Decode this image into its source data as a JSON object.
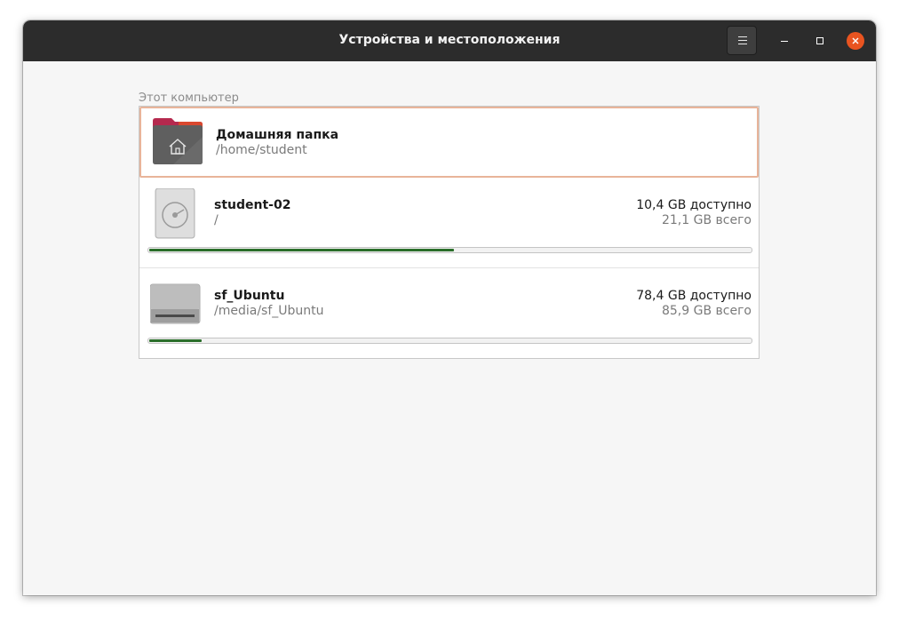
{
  "window": {
    "title": "Устройства и местоположения"
  },
  "section": {
    "label": "Этот компьютер"
  },
  "items": [
    {
      "name": "Домашняя папка",
      "path": "/home/student",
      "icon": "home-folder-icon"
    },
    {
      "name": "student-02",
      "path": "/",
      "free": "10,4 GB доступно",
      "total": "21,1 GB всего",
      "used_fraction": 0.507,
      "icon": "disk-icon"
    },
    {
      "name": "sf_Ubuntu",
      "path": "/media/sf_Ubuntu",
      "free": "78,4 GB доступно",
      "total": "85,9 GB всего",
      "used_fraction": 0.087,
      "icon": "drive-icon"
    }
  ],
  "colors": {
    "accent": "#e95420",
    "selection_border": "#e8b49a",
    "usage_fill": "#2a6e2a",
    "folder_top": "#b5294e",
    "folder_body": "#5f5f5f"
  }
}
